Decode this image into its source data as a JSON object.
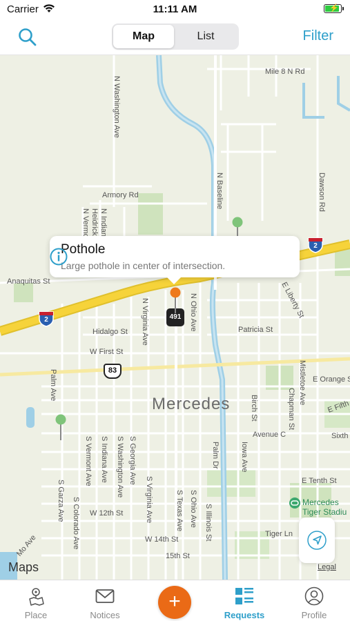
{
  "status": {
    "carrier": "Carrier",
    "time": "11:11 AM"
  },
  "nav": {
    "segments": [
      "Map",
      "List"
    ],
    "filter": "Filter"
  },
  "map": {
    "city": "Mercedes",
    "attribution": "Maps",
    "legal": "Legal",
    "callout": {
      "title": "Pothole",
      "description": "Large pothole in center of intersection."
    },
    "shields": {
      "interstate": "2",
      "us_route": "83",
      "state": "491"
    },
    "streets": {
      "mile8": "Mile 8 N Rd",
      "nwashington": "N Washington Ave",
      "armory": "Armory Rd",
      "nindiana": "N Indiana Ave",
      "nheidrick": "Heidrick",
      "nvermont": "N Vermont",
      "nbaseline": "N Baseline",
      "dawson": "Dawson Rd",
      "anaquitas": "Anaquitas St",
      "eliberty": "E Liberty St",
      "nvirginia": "N Virginia Ave",
      "nohio": "N Ohio Ave",
      "hidalgo": "Hidalgo St",
      "patricia": "Patricia St",
      "wfirst": "W First St",
      "eorange": "E Orange St",
      "palm": "Palm Ave",
      "birch": "Birch St",
      "chapman": "Chapman St",
      "mistletoe": "Mistletoe Ave",
      "efifth": "E Fifth S",
      "avenuec": "Avenue C",
      "sixth": "Sixth",
      "svermont": "S Vermont Ave",
      "sindiana": "S Indiana Ave",
      "swashington": "S Washington Ave",
      "sgeorgia": "S Georgia Ave",
      "svirginia": "S Virginia Ave",
      "palmdr": "Palm Dr",
      "iowa": "Iowa Ave",
      "etenth": "E Tenth St",
      "sgarza": "S Garza Ave",
      "scolorado": "S Colorado Ave",
      "w12th": "W 12th St",
      "stexas": "S Texas Ave",
      "sohio": "S Ohio Ave",
      "sillinois": "S Illinois St",
      "w14th": "W 14th St",
      "tigerln": "Tiger Ln",
      "fifteenth": "15th St",
      "mo": "Mo Ave",
      "tigerstadium": "Mercedes\nTiger Stadiu"
    }
  },
  "tabs": [
    {
      "label": "Place",
      "icon": "place-pin-icon"
    },
    {
      "label": "Notices",
      "icon": "mail-icon"
    },
    {
      "label": "Requests",
      "icon": "list-icon"
    },
    {
      "label": "Profile",
      "icon": "profile-icon"
    }
  ],
  "colors": {
    "accent": "#2e9fca",
    "add": "#ea6a16",
    "highway": "#f6d33a",
    "water": "#9fcfe6"
  }
}
